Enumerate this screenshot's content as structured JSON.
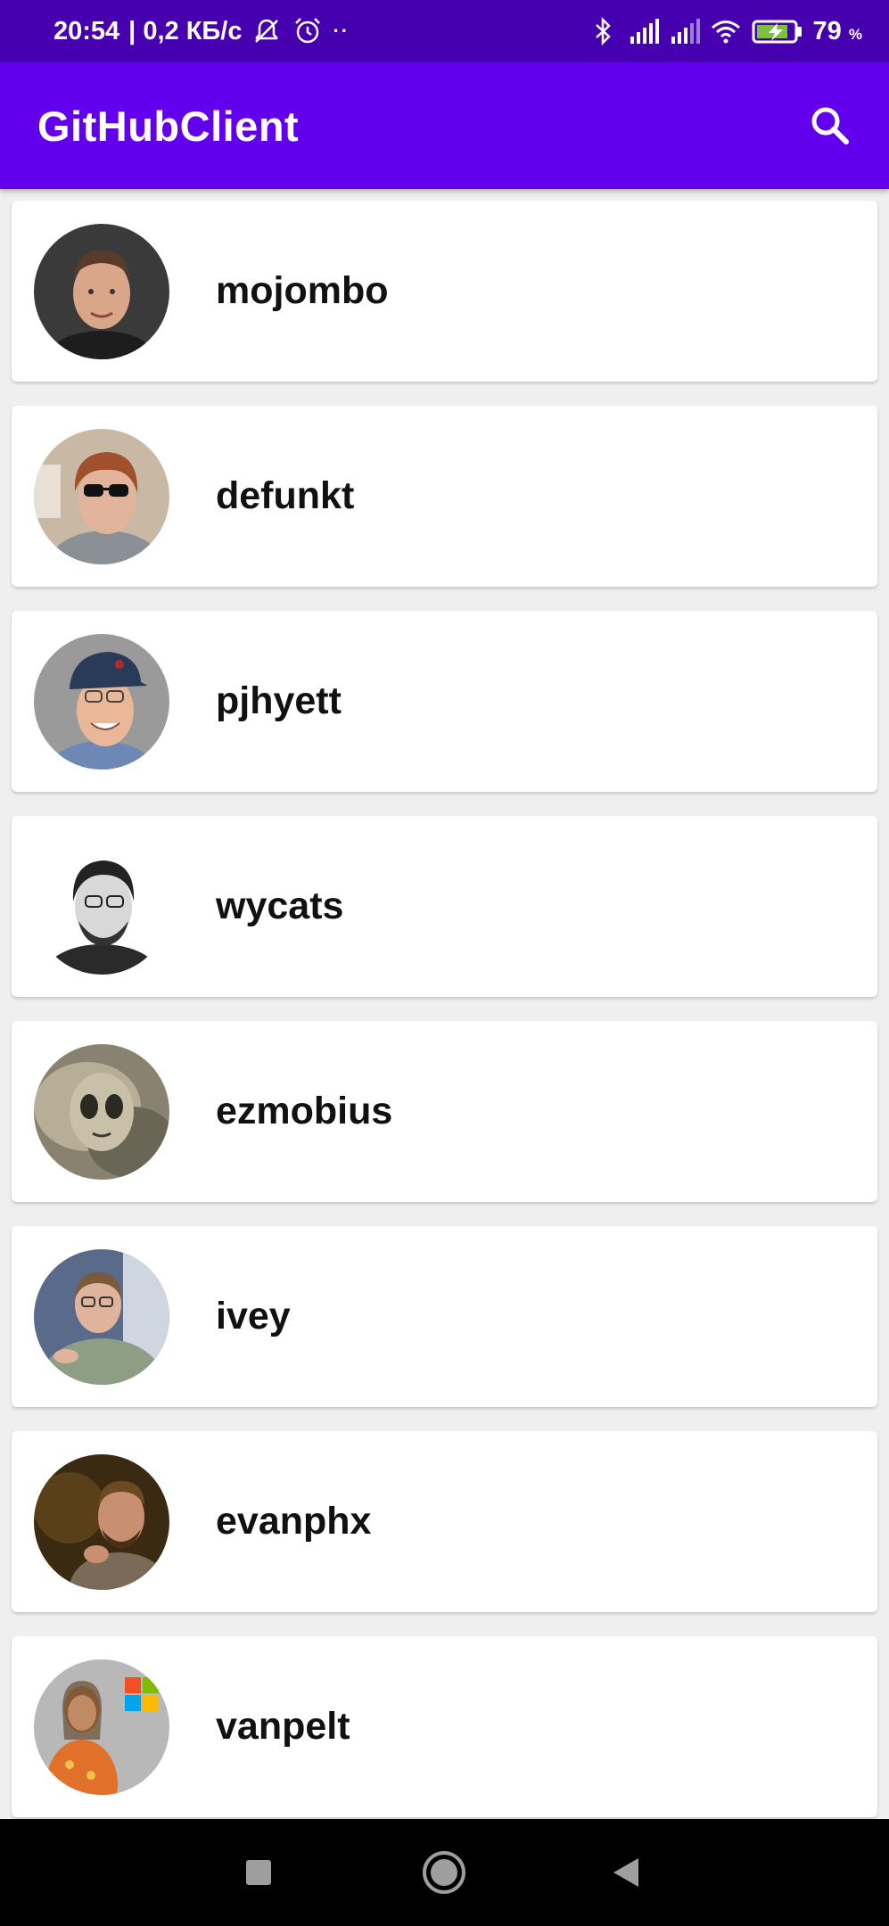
{
  "status_bar": {
    "time": "20:54",
    "speed": "| 0,2 КБ/с",
    "more_indicator": "··",
    "battery_value": "79",
    "battery_unit": "%",
    "icons": [
      "muted-bell-icon",
      "alarm-icon",
      "bluetooth-icon",
      "signal-icon",
      "signal-icon",
      "wifi-icon",
      "battery-charging-icon"
    ]
  },
  "app_bar": {
    "title": "GitHubClient",
    "search_icon": "search-icon"
  },
  "colors": {
    "status_bar": "#4700b0",
    "app_bar": "#6200ee",
    "background": "#efefef",
    "card": "#ffffff",
    "text": "#111111"
  },
  "users": [
    {
      "login": "mojombo"
    },
    {
      "login": "defunkt"
    },
    {
      "login": "pjhyett"
    },
    {
      "login": "wycats"
    },
    {
      "login": "ezmobius"
    },
    {
      "login": "ivey"
    },
    {
      "login": "evanphx"
    },
    {
      "login": "vanpelt"
    }
  ],
  "nav_bar": {
    "icons": [
      "recents-square-icon",
      "home-circle-icon",
      "back-triangle-icon"
    ]
  }
}
